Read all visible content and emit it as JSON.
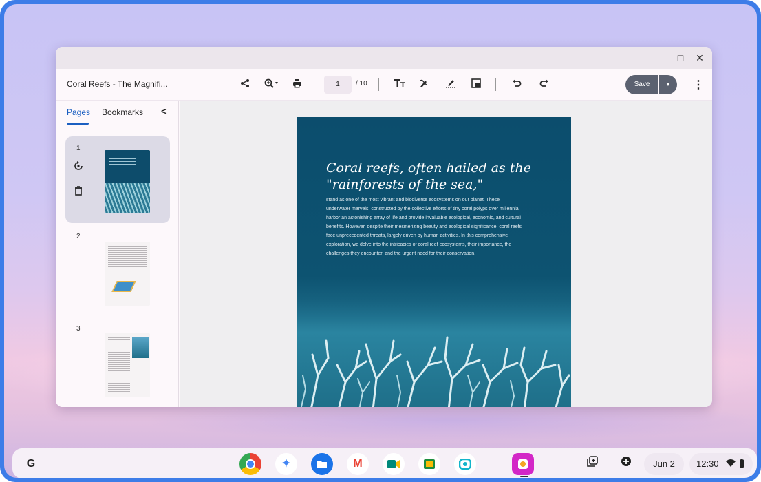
{
  "window": {
    "title": "Coral Reefs - The Magnifi...",
    "controls": {
      "minimize": "_",
      "maximize": "□",
      "close": "✕"
    }
  },
  "toolbar": {
    "page_current": "1",
    "page_total": "/ 10",
    "save_label": "Save",
    "icons": [
      "share-icon",
      "zoom-icon",
      "print-icon",
      "text-icon",
      "draw-icon",
      "signature-icon",
      "image-icon",
      "undo-icon",
      "redo-icon",
      "more-icon"
    ]
  },
  "sidebar": {
    "tabs": [
      {
        "label": "Pages",
        "active": true
      },
      {
        "label": "Bookmarks",
        "active": false
      }
    ],
    "thumbnails": [
      {
        "number": "1",
        "selected": true
      },
      {
        "number": "2",
        "selected": false
      },
      {
        "number": "3",
        "selected": false
      }
    ]
  },
  "document": {
    "heading": "Coral reefs, often hailed as the \"rainforests of the sea,\"",
    "body": "stand as one of the most vibrant and biodiverse ecosystems on our planet. These underwater marvels, constructed by the collective efforts of tiny coral polyps over millennia, harbor an astonishing array of life and provide invaluable ecological, economic, and cultural benefits. However, despite their mesmerizing beauty and ecological significance, coral reefs face unprecedented threats, largely driven by human activities. In this comprehensive exploration, we delve into the intricacies of coral reef ecosystems, their importance, the challenges they encounter, and the urgent need for their conservation."
  },
  "shelf": {
    "launcher": "G",
    "apps": [
      "chrome",
      "gemini",
      "files",
      "gmail",
      "meet",
      "classroom",
      "screencast",
      "gallery"
    ],
    "date": "Jun 2",
    "time": "12:30"
  },
  "colors": {
    "accent": "#1b5fc1",
    "save_button": "#5b6170",
    "page_bg": "#0c4d6d"
  }
}
